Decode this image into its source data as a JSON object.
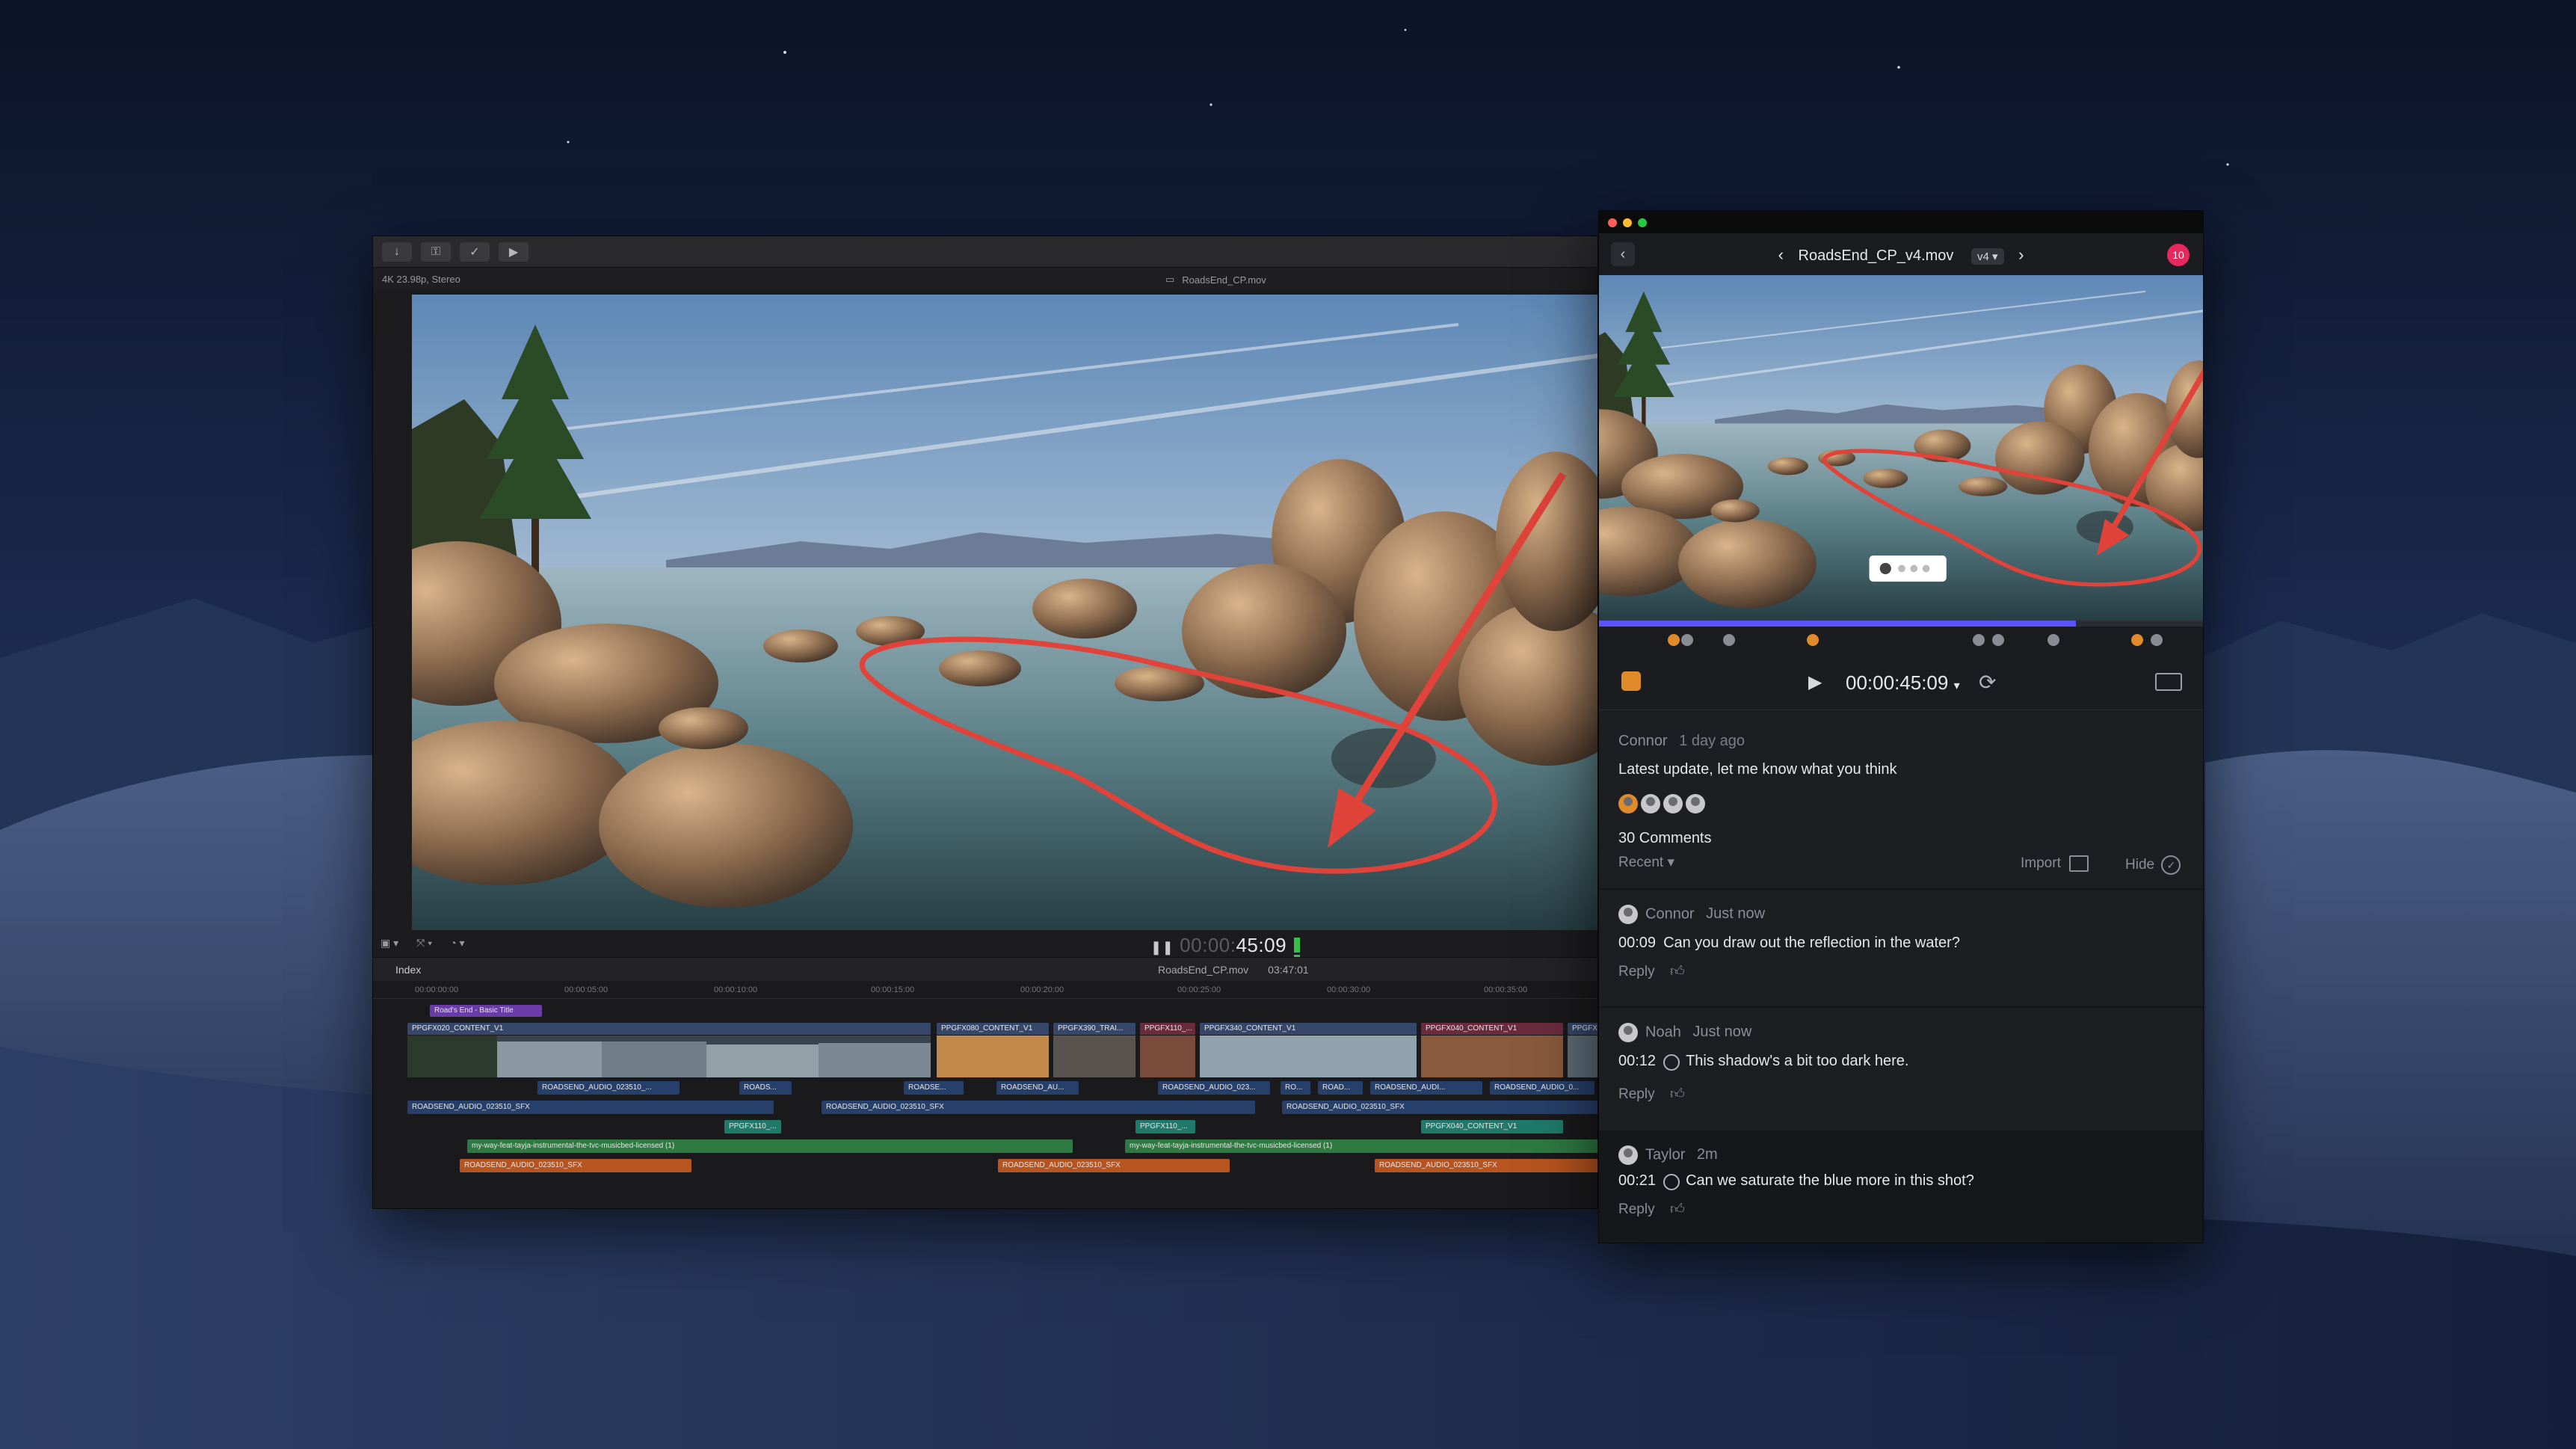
{
  "editor": {
    "format": "4K 23.98p, Stereo",
    "clip_name": "RoadsEnd_CP.mov",
    "timecode_dim": "00:00:",
    "timecode": "45:09",
    "index_label": "Index",
    "project_name": "RoadsEnd_CP.mov",
    "duration": "03:47:01",
    "ruler": [
      "00:00:00:00",
      "00:00:05:00",
      "00:00:10:00",
      "00:00:15:00",
      "00:00:20:00",
      "00:00:25:00",
      "00:00:30:00",
      "00:00:35:00"
    ],
    "title_clip": "Road's End - Basic Title",
    "video_clips": [
      "PPGFX020_CONTENT_V1",
      "PPGFX080_CONTENT_V1",
      "PPGFX390_TRAI...",
      "PPGFX110_...",
      "PPGFX340_CONTENT_V1",
      "PPGFX040_CONTENT_V1",
      "PPGFX..."
    ],
    "audio_row1": [
      "ROADSEND_AUDIO_023510_...",
      "ROADS...",
      "ROADSE...",
      "ROADSEND_AU...",
      "ROADSEND_AUDIO_023...",
      "RO...",
      "ROAD...",
      "ROADSEND_AUDI...",
      "ROADSEND_AUDIO_0..."
    ],
    "audio_row2": [
      "ROADSEND_AUDIO_023510_SFX",
      "ROADSEND_AUDIO_023510_SFX",
      "ROADSEND_AUDIO_023510_SFX"
    ],
    "teal_clips": [
      "PPGFX110_...",
      "PPGFX110_...",
      "PPGFX040_CONTENT_V1"
    ],
    "music": [
      "my-way-feat-tayja-instrumental-the-tvc-musicbed-licensed (1)",
      "my-way-feat-tayja-instrumental-the-tvc-musicbed-licensed (1)"
    ],
    "orange_clips": [
      "ROADSEND_AUDIO_023510_SFX",
      "ROADSEND_AUDIO_023510_SFX",
      "ROADSEND_AUDIO_023510_SFX"
    ]
  },
  "review": {
    "file_name": "RoadsEnd_CP_v4.mov",
    "version": "v4",
    "notifications": "10",
    "progress": 0.79,
    "timecode": "00:00:45:09",
    "post": {
      "author": "Connor",
      "time": "1 day ago",
      "text": "Latest update, let me know what you think"
    },
    "comments_count": "30 Comments",
    "sort": "Recent",
    "import_label": "Import",
    "hide_label": "Hide",
    "reply_label": "Reply",
    "comments": [
      {
        "author": "Connor",
        "time": "Just now",
        "tc": "00:09",
        "text": "Can you draw out the reflection in the water?"
      },
      {
        "author": "Noah",
        "time": "Just now",
        "tc": "00:12",
        "text": "This shadow's a bit too dark here."
      },
      {
        "author": "Taylor",
        "time": "2m",
        "tc": "00:21",
        "text": "Can we saturate the blue more in this shot?"
      }
    ]
  },
  "colors": {
    "accent_purple": "#5b53ff",
    "notif_red": "#e8285c",
    "annotation_red": "#e0433a"
  }
}
